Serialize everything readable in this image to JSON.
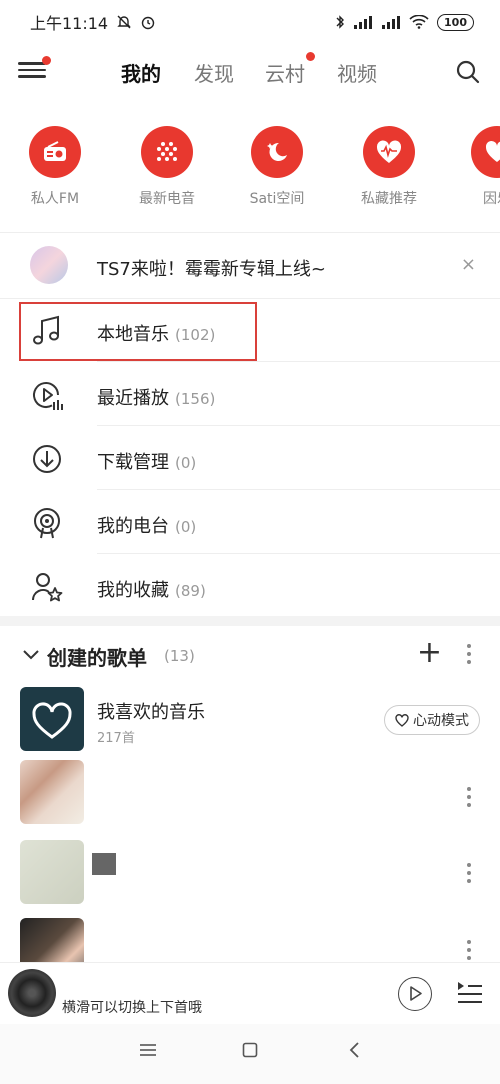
{
  "status_bar": {
    "time": "上午11:14",
    "battery": "100"
  },
  "top_nav": {
    "tabs": [
      {
        "label": "我的",
        "active": true
      },
      {
        "label": "发现",
        "active": false
      },
      {
        "label": "云村",
        "active": false,
        "badge": true
      },
      {
        "label": "视频",
        "active": false
      }
    ]
  },
  "quick_icons": [
    {
      "label": "私人FM",
      "icon": "radio-icon"
    },
    {
      "label": "最新电音",
      "icon": "dot-grid-icon"
    },
    {
      "label": "Sati空间",
      "icon": "moon-icon"
    },
    {
      "label": "私藏推荐",
      "icon": "heart-wave-icon"
    },
    {
      "label": "因乐",
      "icon": "heart-icon"
    }
  ],
  "promo": {
    "text": "TS7来啦！霉霉新专辑上线~",
    "close": "×"
  },
  "library": [
    {
      "label": "本地音乐",
      "count": "(102)",
      "icon": "music-note-icon"
    },
    {
      "label": "最近播放",
      "count": "(156)",
      "icon": "recent-play-icon"
    },
    {
      "label": "下载管理",
      "count": "(0)",
      "icon": "download-icon"
    },
    {
      "label": "我的电台",
      "count": "(0)",
      "icon": "podcast-icon"
    },
    {
      "label": "我的收藏",
      "count": "(89)",
      "icon": "favorite-user-icon"
    }
  ],
  "playlists": {
    "title": "创建的歌单",
    "count": "(13)",
    "items": [
      {
        "name": "我喜欢的音乐",
        "sub": "217首",
        "mode_label": "心动模式"
      },
      {
        "name": "",
        "sub": ""
      },
      {
        "name": "",
        "sub": ""
      },
      {
        "name": "",
        "sub": ""
      }
    ]
  },
  "mini_player": {
    "hint": "横滑可以切换上下首哦"
  },
  "accent_color": "#e8382f"
}
